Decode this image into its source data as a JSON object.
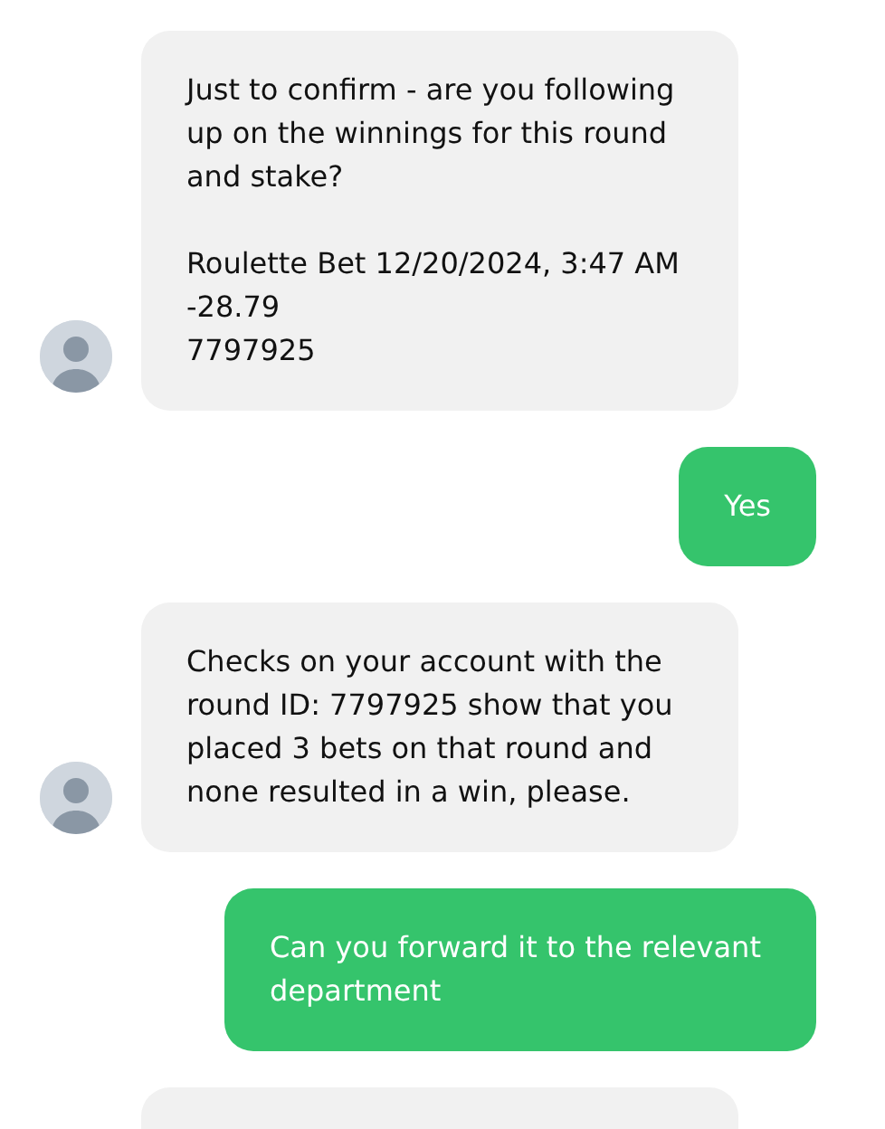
{
  "messages": [
    {
      "kind": "agent",
      "paragraphs": [
        "Just to confirm - are you following up on the winnings for this round and stake?",
        "Roulette Bet 12/20/2024, 3:47 AM\n-28.79\n7797925"
      ]
    },
    {
      "kind": "user",
      "paragraphs": [
        "Yes"
      ]
    },
    {
      "kind": "agent",
      "paragraphs": [
        "Checks on your account with the round ID: 7797925 show that you placed 3 bets on that round and none resulted in a win, please."
      ]
    },
    {
      "kind": "user",
      "paragraphs": [
        "Can you forward it to the relevant department"
      ]
    },
    {
      "kind": "agent",
      "cut_off": true
    }
  ]
}
